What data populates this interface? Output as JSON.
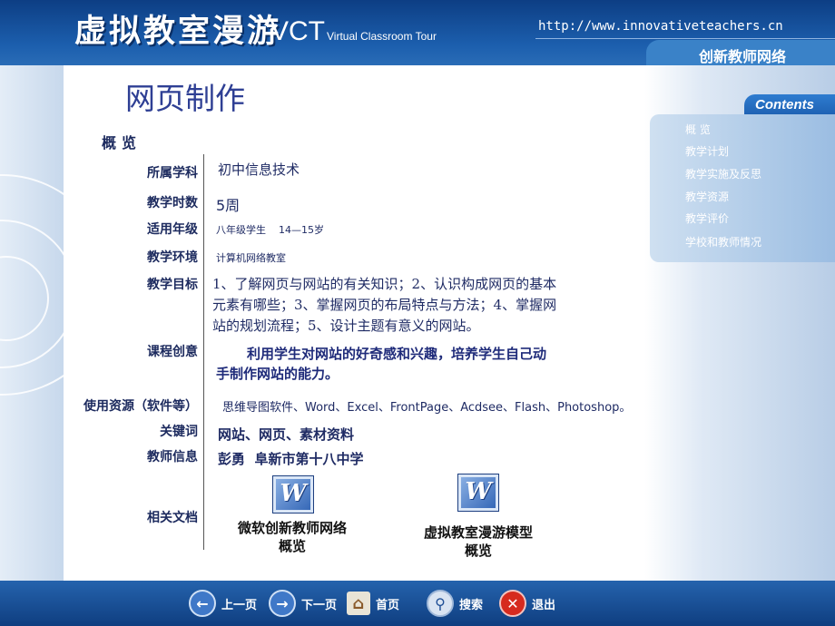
{
  "header": {
    "title": "虚拟教室漫游",
    "vct": "VCT",
    "subtitle": "Virtual Classroom Tour",
    "url": "http://www.innovativeteachers.cn",
    "brand": "创新教师网络"
  },
  "sidebar": {
    "heading": "Contents",
    "items": [
      {
        "label": "概 览"
      },
      {
        "label": "教学计划"
      },
      {
        "label": "教学实施及反思"
      },
      {
        "label": "教学资源"
      },
      {
        "label": "教学评价"
      },
      {
        "label": "学校和教师情况"
      }
    ]
  },
  "main": {
    "title": "网页制作",
    "overview": "概览",
    "fields": {
      "subject": {
        "label": "所属学科",
        "value": "初中信息技术"
      },
      "hours": {
        "label": "教学时数",
        "value": "5周"
      },
      "grade": {
        "label": "适用年级",
        "value": "八年级学生    14—15岁"
      },
      "env": {
        "label": "教学环境",
        "value": "计算机网络教室"
      },
      "goals": {
        "label": "教学目标",
        "lines": [
          "1、了解网页与网站的有关知识；2、认识构成网页的基本",
          "元素有哪些；3、掌握网页的布局特点与方法；4、掌握网",
          "站的规划流程；5、设计主题有意义的网站。"
        ]
      },
      "idea": {
        "label": "课程创意",
        "lines": [
          "利用学生对网站的好奇感和兴趣，培养学生自己动",
          "手制作网站的能力。"
        ]
      },
      "resources": {
        "label": "使用资源（软件等）",
        "value": "思维导图软件、Word、Excel、FrontPage、Acdsee、Flash、Photoshop。"
      },
      "keywords": {
        "label": "关键词",
        "value": "网站、网页、素材资料"
      },
      "teacher": {
        "label": "教师信息",
        "value": "彭勇  阜新市第十八中学"
      },
      "docs": {
        "label": "相关文档"
      }
    },
    "documents": [
      {
        "icon": "word-doc-icon",
        "glyph": "W",
        "label": "微软创新教师网络\n概览"
      },
      {
        "icon": "word-doc-icon",
        "glyph": "W",
        "label": "虚拟教室漫游模型\n概览"
      }
    ]
  },
  "footer": {
    "prev": "上一页",
    "next": "下一页",
    "home": "首页",
    "search": "搜索",
    "exit": "退出"
  }
}
